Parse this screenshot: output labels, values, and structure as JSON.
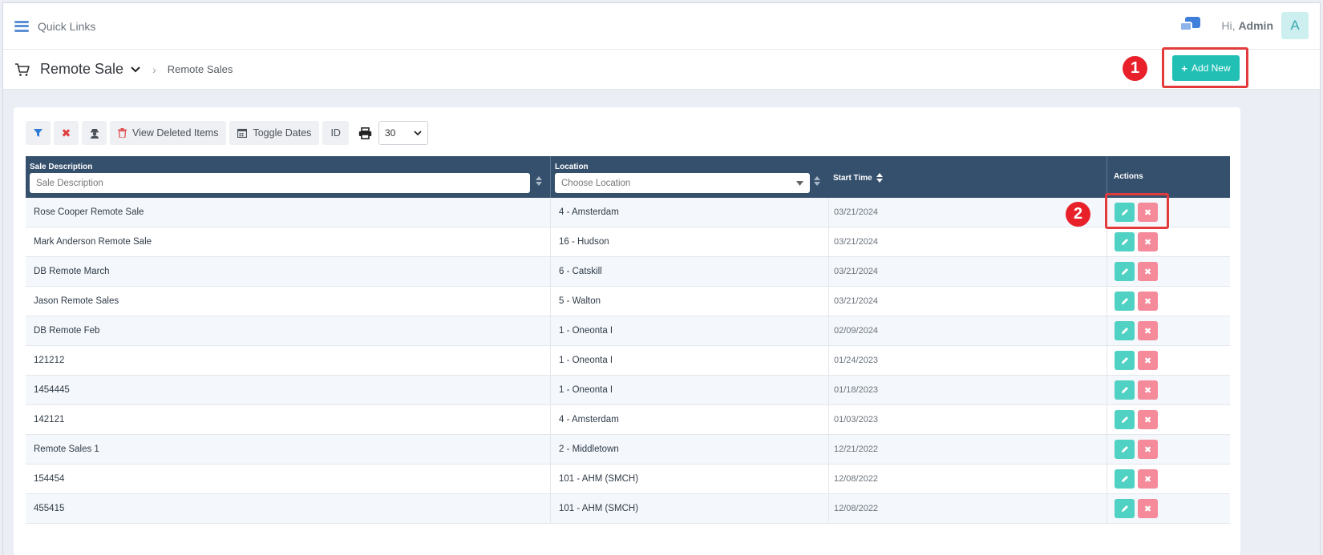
{
  "quick_links": "Quick Links",
  "user": {
    "greeting": "Hi,",
    "name": "Admin",
    "initial": "A"
  },
  "page": {
    "title": "Remote Sale",
    "breadcrumb": "Remote Sales"
  },
  "add_new_label": "Add New",
  "annotations": [
    "1",
    "2"
  ],
  "toolbar": {
    "view_deleted": "View Deleted Items",
    "toggle_dates": "Toggle Dates",
    "id": "ID",
    "page_size": "30"
  },
  "table": {
    "headers": {
      "sale_description": "Sale Description",
      "location": "Location",
      "start_time": "Start Time",
      "actions": "Actions"
    },
    "filters": {
      "sale_description_placeholder": "Sale Description",
      "location_placeholder": "Choose Location"
    },
    "rows": [
      {
        "description": "Rose Cooper Remote Sale",
        "location": "4 - Amsterdam",
        "start": "03/21/2024"
      },
      {
        "description": "Mark Anderson Remote Sale",
        "location": "16 - Hudson",
        "start": "03/21/2024"
      },
      {
        "description": "DB Remote March",
        "location": "6 - Catskill",
        "start": "03/21/2024"
      },
      {
        "description": "Jason Remote Sales",
        "location": "5 - Walton",
        "start": "03/21/2024"
      },
      {
        "description": "DB Remote Feb",
        "location": "1 - Oneonta I",
        "start": "02/09/2024"
      },
      {
        "description": "121212",
        "location": "1 - Oneonta I",
        "start": "01/24/2023"
      },
      {
        "description": "1454445",
        "location": "1 - Oneonta I",
        "start": "01/18/2023"
      },
      {
        "description": "142121",
        "location": "4 - Amsterdam",
        "start": "01/03/2023"
      },
      {
        "description": "Remote Sales 1",
        "location": "2 - Middletown",
        "start": "12/21/2022"
      },
      {
        "description": "154454",
        "location": "101 - AHM (SMCH)",
        "start": "12/08/2022"
      },
      {
        "description": "455415",
        "location": "101 - AHM (SMCH)",
        "start": "12/08/2022"
      }
    ]
  },
  "colors": {
    "header_bg": "#35506d",
    "accent": "#22bfb5",
    "edit": "#4fd1c3",
    "delete": "#f48a9a",
    "annotation": "#e8202a"
  }
}
